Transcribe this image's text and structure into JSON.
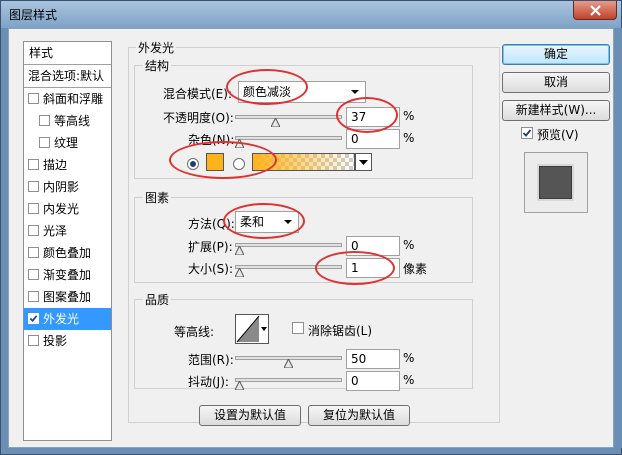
{
  "window": {
    "title": "图层样式"
  },
  "sidebar": {
    "header": "样式",
    "blend_options": "混合选项:默认",
    "items": [
      {
        "label": "斜面和浮雕",
        "checked": false,
        "indent": 0
      },
      {
        "label": "等高线",
        "checked": false,
        "indent": 1
      },
      {
        "label": "纹理",
        "checked": false,
        "indent": 1
      },
      {
        "label": "描边",
        "checked": false,
        "indent": 0
      },
      {
        "label": "内阴影",
        "checked": false,
        "indent": 0
      },
      {
        "label": "内发光",
        "checked": false,
        "indent": 0
      },
      {
        "label": "光泽",
        "checked": false,
        "indent": 0
      },
      {
        "label": "颜色叠加",
        "checked": false,
        "indent": 0
      },
      {
        "label": "渐变叠加",
        "checked": false,
        "indent": 0
      },
      {
        "label": "图案叠加",
        "checked": false,
        "indent": 0
      },
      {
        "label": "外发光",
        "checked": true,
        "indent": 0,
        "selected": true
      },
      {
        "label": "投影",
        "checked": false,
        "indent": 0
      }
    ]
  },
  "panel": {
    "title": "外发光",
    "structure": {
      "title": "结构",
      "blend_mode_label": "混合模式(E):",
      "blend_mode_value": "颜色减淡",
      "opacity_label": "不透明度(O):",
      "opacity_value": "37",
      "opacity_fraction": 0.37,
      "noise_label": "杂色(N):",
      "noise_value": "0",
      "noise_fraction": 0,
      "color": "#ffb31a",
      "percent": "%"
    },
    "elements": {
      "title": "图素",
      "method_label": "方法(Q):",
      "method_value": "柔和",
      "spread_label": "扩展(P):",
      "spread_value": "0",
      "spread_fraction": 0,
      "size_label": "大小(S):",
      "size_value": "1",
      "size_fraction": 0.004,
      "size_unit": "像素",
      "percent": "%"
    },
    "quality": {
      "title": "品质",
      "contour_label": "等高线:",
      "antialias_label": "消除锯齿(L)",
      "antialias_checked": false,
      "range_label": "范围(R):",
      "range_value": "50",
      "range_fraction": 0.5,
      "jitter_label": "抖动(J):",
      "jitter_value": "0",
      "jitter_fraction": 0,
      "percent": "%"
    },
    "make_default": "设置为默认值",
    "reset_default": "复位为默认值"
  },
  "buttons": {
    "ok": "确定",
    "cancel": "取消",
    "new_style": "新建样式(W)...",
    "preview_label": "预览(V)",
    "preview_checked": true
  }
}
